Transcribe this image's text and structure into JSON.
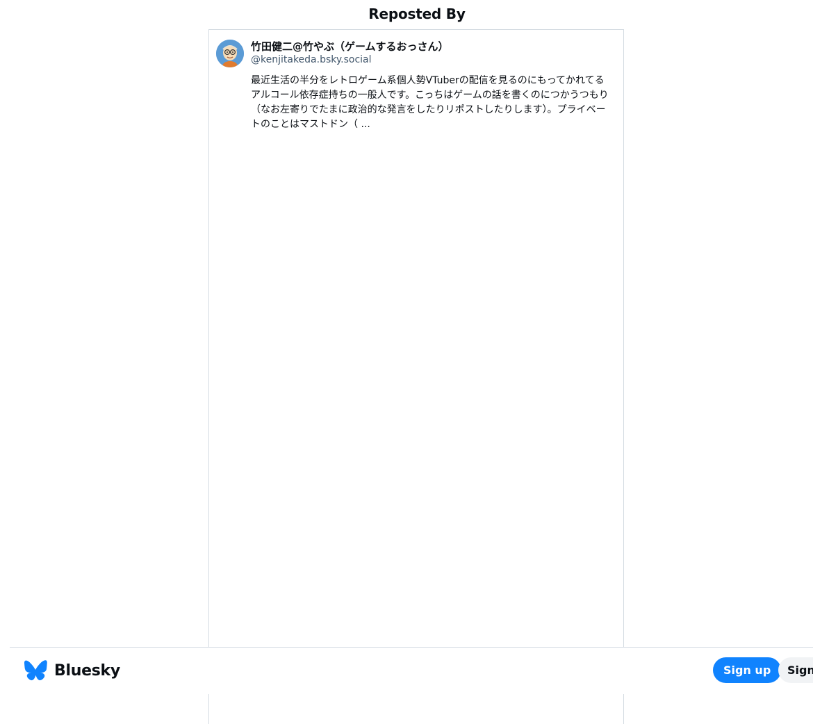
{
  "header": {
    "title": "Reposted By"
  },
  "reposters": [
    {
      "display_name": "竹田健二@竹やぶ（ゲームするおっさん）",
      "handle": "@kenjitakeda.bsky.social",
      "bio": "最近生活の半分をレトロゲーム系個人勢VTuberの配信を見るのにもってかれてるアルコール依存症持ちの一般人です。こっちはゲームの話を書くのにつかうつもり（なお左寄りでたまに政治的な発言をしたりリポストしたりします）。プライベートのことはマストドン（ ...",
      "avatar_icon": "cartoon-avatar-icon"
    }
  ],
  "bottom_bar": {
    "brand_name": "Bluesky",
    "brand_icon": "butterfly-logo-icon",
    "signup_label": "Sign up",
    "signin_label": "Sign in"
  },
  "colors": {
    "accent": "#1083fe",
    "border": "#d4dbe2",
    "handle_text": "#42576c"
  }
}
